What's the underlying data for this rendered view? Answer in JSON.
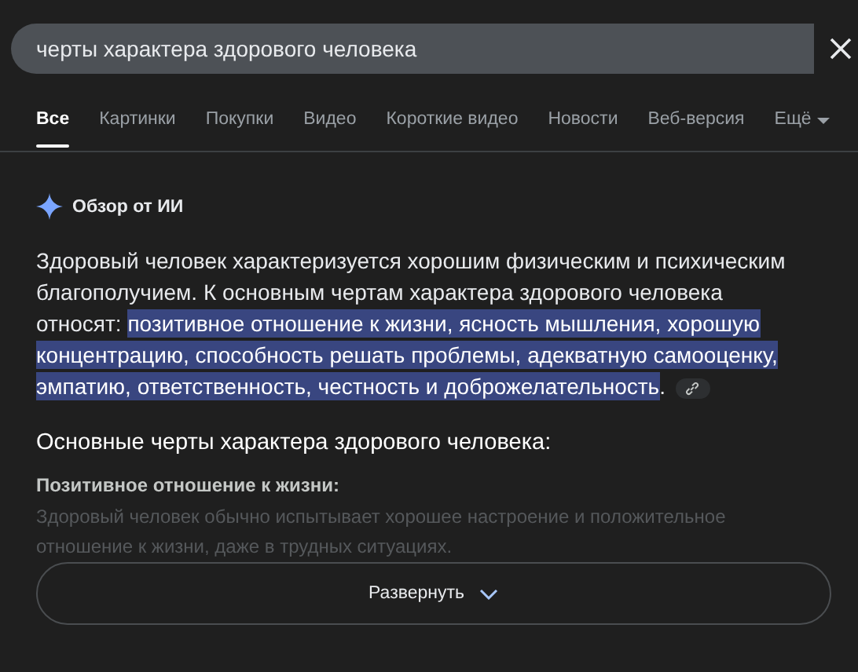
{
  "search": {
    "value": "черты характера здорового человека"
  },
  "tabs": [
    {
      "label": "Все",
      "selected": true
    },
    {
      "label": "Картинки",
      "selected": false
    },
    {
      "label": "Покупки",
      "selected": false
    },
    {
      "label": "Видео",
      "selected": false
    },
    {
      "label": "Короткие видео",
      "selected": false
    },
    {
      "label": "Новости",
      "selected": false
    },
    {
      "label": "Веб-версия",
      "selected": false
    },
    {
      "label": "Ещё",
      "selected": false,
      "kind": "menu"
    }
  ],
  "overview": {
    "title": "Обзор от ИИ",
    "summary": {
      "before": "Здоровый человек характеризуется хорошим физическим и психическим благополучием. К основным чертам характера здорового человека относят: ",
      "highlighted": "позитивное отношение к жизни, ясность мышления, хорошую концентрацию, способность решать проблемы, адекватную самооценку, эмпатию, ответственность, честность и доброжелательность",
      "after": "."
    },
    "heading": "Основные черты характера здорового человека:",
    "points": [
      {
        "title": "Позитивное отношение к жизни:",
        "text": "Здоровый человек обычно испытывает хорошее настроение и положительное отношение к жизни, даже в трудных ситуациях."
      }
    ],
    "expand_button": "Развернуть"
  }
}
